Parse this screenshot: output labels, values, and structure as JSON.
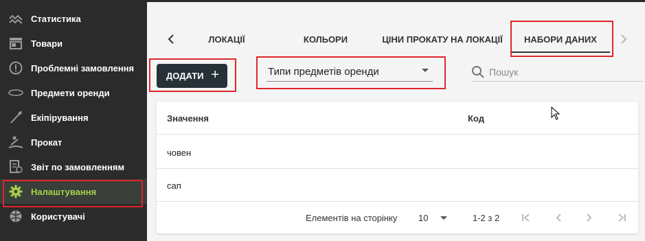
{
  "sidebar": {
    "items": [
      {
        "label": "Статистика",
        "icon": "line-chart-icon"
      },
      {
        "label": "Товари",
        "icon": "store-icon"
      },
      {
        "label": "Проблемні замовлення",
        "icon": "alert-circle-icon"
      },
      {
        "label": "Предмети оренди",
        "icon": "surfboard-icon"
      },
      {
        "label": "Екіпірування",
        "icon": "paddle-icon"
      },
      {
        "label": "Прокат",
        "icon": "rowing-icon"
      },
      {
        "label": "Звіт по замовленням",
        "icon": "report-icon"
      },
      {
        "label": "Налаштування",
        "icon": "gear-icon"
      },
      {
        "label": "Користувачі",
        "icon": "ball-icon"
      }
    ],
    "active_index": 7
  },
  "tabs": {
    "items": [
      "ЛОКАЦІЇ",
      "КОЛЬОРИ",
      "ЦІНИ ПРОКАТУ НА ЛОКАЦІЇ",
      "НАБОРИ ДАНИХ"
    ],
    "active_index": 3
  },
  "toolbar": {
    "add_label": "ДОДАТИ",
    "add_icon": "+",
    "select_value": "Типи предметів оренди",
    "search_placeholder": "Пошук"
  },
  "table": {
    "columns": [
      "Значення",
      "Код"
    ],
    "rows": [
      [
        "човен",
        ""
      ],
      [
        "сап",
        ""
      ]
    ]
  },
  "pagination": {
    "per_page_label": "Елементів на сторінку",
    "per_page_value": "10",
    "range_label": "1-2 з 2"
  },
  "colors": {
    "sidebar_bg": "#2b2b2b",
    "accent": "#a7d14b",
    "button_bg": "#263238",
    "highlight": "#e0262b"
  }
}
